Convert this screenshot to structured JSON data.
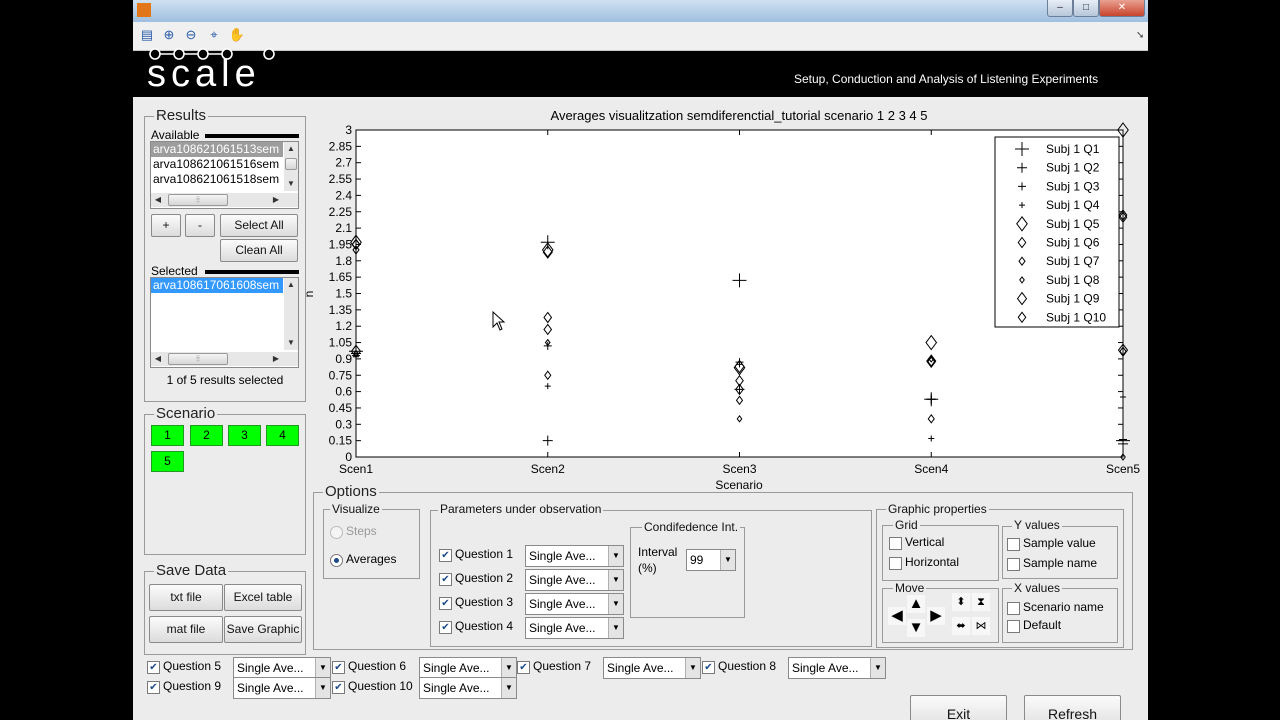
{
  "window": {
    "minimize": "–",
    "maximize": "□",
    "close": "✕"
  },
  "toolbar": {
    "icons": [
      "legend-icon",
      "zoom-in-icon",
      "zoom-out-icon",
      "data-cursor-icon",
      "pan-hand-icon"
    ]
  },
  "banner": {
    "logo": "scale",
    "tagline": "Setup, Conduction and Analysis of Listening Experiments"
  },
  "results": {
    "title": "Results",
    "available_label": "Available",
    "available_items": [
      "arva108621061513sem",
      "arva108621061516sem",
      "arva108621061518sem"
    ],
    "plus_label": "+",
    "minus_label": "-",
    "select_all_label": "Select All",
    "clean_all_label": "Clean All",
    "selected_label": "Selected",
    "selected_items": [
      "arva108617061608sem"
    ],
    "status": "1 of 5 results selected"
  },
  "scenario_panel": {
    "title": "Scenario",
    "buttons": [
      "1",
      "2",
      "3",
      "4",
      "5"
    ]
  },
  "save_data": {
    "title": "Save Data",
    "txt_label": "txt file",
    "excel_label": "Excel table",
    "mat_label": "mat file",
    "graphic_label": "Save Graphic"
  },
  "chart_data": {
    "type": "scatter",
    "title": "Averages visualitzation semdiferenctial_tutorial scenario  1  2  3  4  5",
    "xlabel": "Scenario",
    "ylabel": "n",
    "categories": [
      "Scen1",
      "Scen2",
      "Scen3",
      "Scen4",
      "Scen5"
    ],
    "ylim": [
      0,
      3
    ],
    "yticks": [
      0,
      0.15,
      0.3,
      0.45,
      0.6,
      0.75,
      0.9,
      1.05,
      1.2,
      1.35,
      1.5,
      1.65,
      1.8,
      1.95,
      2.1,
      2.25,
      2.4,
      2.55,
      2.7,
      2.85,
      3
    ],
    "grid": false,
    "legend_position": "top-right",
    "series": [
      {
        "name": "Subj 1 Q1",
        "marker": "plus",
        "size": 7,
        "values": [
          0.97,
          1.97,
          1.62,
          0.53,
          0.15
        ]
      },
      {
        "name": "Subj 1 Q2",
        "marker": "plus",
        "size": 5,
        "values": [
          0.95,
          0.15,
          0.62,
          0.53,
          0.12
        ]
      },
      {
        "name": "Subj 1 Q3",
        "marker": "plus",
        "size": 4,
        "values": [
          0.93,
          1.02,
          0.87,
          0.53,
          0.16
        ]
      },
      {
        "name": "Subj 1 Q4",
        "marker": "plus",
        "size": 3,
        "values": [
          0.92,
          0.65,
          0.85,
          0.17,
          0.55
        ]
      },
      {
        "name": "Subj 1 Q5",
        "marker": "diamond",
        "size": 7,
        "values": [
          1.97,
          1.9,
          0.82,
          1.05,
          3.0
        ]
      },
      {
        "name": "Subj 1 Q6",
        "marker": "diamond",
        "size": 5,
        "values": [
          1.95,
          1.28,
          0.7,
          0.88,
          2.22
        ]
      },
      {
        "name": "Subj 1 Q7",
        "marker": "diamond",
        "size": 4,
        "values": [
          1.9,
          0.75,
          0.52,
          0.35,
          0.97
        ]
      },
      {
        "name": "Subj 1 Q8",
        "marker": "diamond",
        "size": 3,
        "values": [
          0.95,
          1.05,
          0.35,
          0.9,
          0.0
        ]
      },
      {
        "name": "Subj 1 Q9",
        "marker": "diamond",
        "size": 6,
        "values": [
          0.97,
          1.88,
          0.83,
          0.88,
          0.98
        ]
      },
      {
        "name": "Subj 1 Q10",
        "marker": "diamond",
        "size": 5,
        "values": [
          1.95,
          1.17,
          0.62,
          0.87,
          2.2
        ]
      }
    ]
  },
  "options": {
    "title": "Options",
    "visualize": {
      "title": "Visualize",
      "steps_label": "Steps",
      "averages_label": "Averages"
    },
    "params": {
      "title": "Parameters under observation",
      "questions": [
        {
          "label": "Question 1",
          "value": "Single Ave..."
        },
        {
          "label": "Question 2",
          "value": "Single Ave..."
        },
        {
          "label": "Question 3",
          "value": "Single Ave..."
        },
        {
          "label": "Question 4",
          "value": "Single Ave..."
        }
      ]
    },
    "conf": {
      "title": "Condifedence Int.",
      "interval_label": "Interval",
      "pct_label": "(%)",
      "value": "99"
    },
    "graphic": {
      "title": "Graphic properties",
      "grid_title": "Grid",
      "vertical_label": "Vertical",
      "horizontal_label": "Horizontal",
      "yvalues_title": "Y values",
      "sample_value_label": "Sample value",
      "sample_name_label": "Sample name",
      "move_title": "Move",
      "xvalues_title": "X values",
      "scenario_name_label": "Scenario name",
      "default_label": "Default"
    }
  },
  "extra_questions": [
    {
      "label": "Question 5",
      "value": "Single Ave..."
    },
    {
      "label": "Question 6",
      "value": "Single Ave..."
    },
    {
      "label": "Question 7",
      "value": "Single Ave..."
    },
    {
      "label": "Question 8",
      "value": "Single Ave..."
    },
    {
      "label": "Question 9",
      "value": "Single Ave..."
    },
    {
      "label": "Question 10",
      "value": "Single Ave..."
    }
  ],
  "actions": {
    "exit_label": "Exit",
    "refresh_label": "Refresh"
  }
}
